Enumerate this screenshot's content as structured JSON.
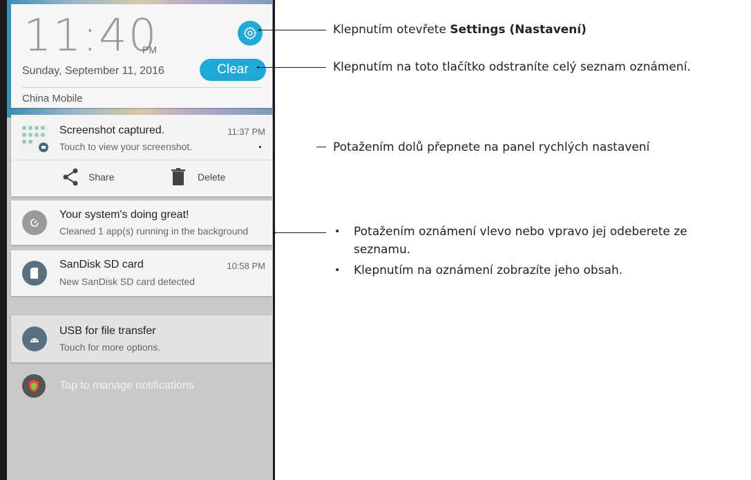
{
  "header": {
    "time": "11:40",
    "ampm": "PM",
    "date": "Sunday, September 11, 2016",
    "clear_label": "Clear",
    "carrier": "China Mobile"
  },
  "notifications": [
    {
      "title": "Screenshot captured.",
      "subtitle": "Touch to view your screenshot.",
      "time": "11:37 PM",
      "actions": [
        "Share",
        "Delete"
      ]
    },
    {
      "title": "Your system's doing great!",
      "subtitle": "Cleaned 1 app(s) running in the background"
    },
    {
      "title": "SanDisk SD card",
      "subtitle": "New SanDisk SD card detected",
      "time": "10:58 PM"
    },
    {
      "title": "USB for file transfer",
      "subtitle": "Touch for more options."
    }
  ],
  "manage_label": "Tap to manage notifications",
  "annotations": {
    "settings_prefix": "Klepnutím otevřete ",
    "settings_bold": "Settings (Nastavení)",
    "clear": "Klepnutím na toto tlačítko odstraníte celý seznam oznámení.",
    "quick": "Potažením dolů přepnete na panel rychlých nastavení",
    "bullets": [
      "Potažením oznámení vlevo nebo vpravo jej odeberete ze seznamu.",
      "Klepnutím na oznámení zobrazíte jeho obsah."
    ]
  },
  "colors": {
    "accent": "#1fa9d6",
    "icon_gray": "#5a7080"
  }
}
